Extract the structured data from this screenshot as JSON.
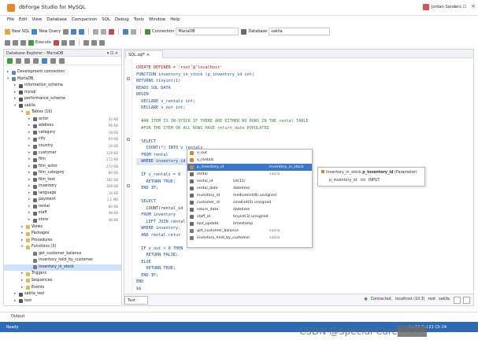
{
  "window": {
    "title": "dbForge Studio for MySQL",
    "user": "Jordan Sanders"
  },
  "menu": [
    "File",
    "Edit",
    "View",
    "Database",
    "Comparison",
    "SQL",
    "Debug",
    "Tools",
    "Window",
    "Help"
  ],
  "toolbar1": {
    "new_sql": "New SQL",
    "new_query": "New Query",
    "connection_label": "Connection",
    "connection_value": "MariaDB",
    "database_label": "Database",
    "database_value": "sakila"
  },
  "toolbar2": {
    "execute": "Execute"
  },
  "explorer": {
    "title": "Database Explorer - MariaDB",
    "items": [
      {
        "label": "Development connection",
        "level": 0,
        "arrow": "▸",
        "color": "#5a86c5"
      },
      {
        "label": "MariaDB",
        "level": 0,
        "arrow": "▾",
        "color": "#5a86c5"
      },
      {
        "label": "information_schema",
        "level": 1,
        "arrow": "▸",
        "color": "#555"
      },
      {
        "label": "mysql",
        "level": 1,
        "arrow": "▸",
        "color": "#555"
      },
      {
        "label": "performance_schema",
        "level": 1,
        "arrow": "▸",
        "color": "#555"
      },
      {
        "label": "sakila",
        "level": 1,
        "arrow": "▾",
        "color": "#555"
      },
      {
        "label": "Tables (16)",
        "level": 2,
        "arrow": "▾",
        "color": "#e3b84c"
      },
      {
        "label": "actor",
        "level": 3,
        "arrow": "▸",
        "color": "#6b6b6b",
        "size": "32 KB"
      },
      {
        "label": "address",
        "level": 3,
        "arrow": "▸",
        "color": "#6b6b6b",
        "size": "96 KB"
      },
      {
        "label": "category",
        "level": 3,
        "arrow": "▸",
        "color": "#6b6b6b",
        "size": "16 KB"
      },
      {
        "label": "city",
        "level": 3,
        "arrow": "▸",
        "color": "#6b6b6b",
        "size": "64 KB"
      },
      {
        "label": "country",
        "level": 3,
        "arrow": "▸",
        "color": "#6b6b6b",
        "size": "16 KB"
      },
      {
        "label": "customer",
        "level": 3,
        "arrow": "▸",
        "color": "#6b6b6b",
        "size": "128 KB"
      },
      {
        "label": "film",
        "level": 3,
        "arrow": "▸",
        "color": "#6b6b6b",
        "size": "272 KB"
      },
      {
        "label": "film_actor",
        "level": 3,
        "arrow": "▸",
        "color": "#6b6b6b",
        "size": "272 KB"
      },
      {
        "label": "film_category",
        "level": 3,
        "arrow": "▸",
        "color": "#6b6b6b",
        "size": "80 KB"
      },
      {
        "label": "film_text",
        "level": 3,
        "arrow": "▸",
        "color": "#6b6b6b",
        "size": "182 KB"
      },
      {
        "label": "inventory",
        "level": 3,
        "arrow": "▸",
        "color": "#6b6b6b",
        "size": "368 KB"
      },
      {
        "label": "language",
        "level": 3,
        "arrow": "▸",
        "color": "#6b6b6b",
        "size": "16 KB"
      },
      {
        "label": "payment",
        "level": 3,
        "arrow": "▸",
        "color": "#6b6b6b",
        "size": "2.1 MB"
      },
      {
        "label": "rental",
        "level": 3,
        "arrow": "▸",
        "color": "#6b6b6b",
        "size": "80 KB"
      },
      {
        "label": "staff",
        "level": 3,
        "arrow": "▸",
        "color": "#6b6b6b",
        "size": "48 KB"
      },
      {
        "label": "store",
        "level": 3,
        "arrow": "▸",
        "color": "#6b6b6b",
        "size": "48 KB"
      },
      {
        "label": "Views",
        "level": 2,
        "arrow": "▸",
        "color": "#e3b84c"
      },
      {
        "label": "Packages",
        "level": 2,
        "arrow": "▸",
        "color": "#e3b84c"
      },
      {
        "label": "Procedures",
        "level": 2,
        "arrow": "▸",
        "color": "#e3b84c"
      },
      {
        "label": "Functions (3)",
        "level": 2,
        "arrow": "▾",
        "color": "#e3b84c"
      },
      {
        "label": "get_customer_balance",
        "level": 3,
        "arrow": "",
        "color": "#7a7a7a"
      },
      {
        "label": "inventory_held_by_customer",
        "level": 3,
        "arrow": "",
        "color": "#7a7a7a"
      },
      {
        "label": "inventory_in_stock",
        "level": 3,
        "arrow": "",
        "color": "#7a7a7a",
        "selected": true
      },
      {
        "label": "Triggers",
        "level": 2,
        "arrow": "▸",
        "color": "#e3b84c"
      },
      {
        "label": "Sequences",
        "level": 2,
        "arrow": "▸",
        "color": "#e3b84c"
      },
      {
        "label": "Events",
        "level": 2,
        "arrow": "▸",
        "color": "#e3b84c"
      },
      {
        "label": "sakila_test",
        "level": 1,
        "arrow": "▸",
        "color": "#555"
      },
      {
        "label": "test",
        "level": 1,
        "arrow": "▸",
        "color": "#555"
      }
    ]
  },
  "editor": {
    "tab": "SQL.sql*",
    "code": [
      "CREATE DEFINER = 'root'@'localhost'",
      "FUNCTION inventory_in_stock (p_inventory_id int)",
      "RETURNS tinyint(1)",
      "READS SQL DATA",
      "BEGIN",
      "  DECLARE v_rentals int;",
      "  DECLARE v_out int;",
      "",
      "  #AN ITEM IS IN-STOCK IF THERE ARE EITHER NO ROWS IN THE rental TABLE",
      "  #FOR THE ITEM OR ALL ROWS HAVE return_date POPULATED",
      "",
      "  SELECT",
      "    COUNT(*) INTO v_rentals",
      "  FROM rental",
      "  WHERE inventory_id = ;",
      "",
      "  IF v_rentals = 0",
      "    RETURN TRUE;",
      "  END IF;",
      "",
      "  SELECT",
      "    COUNT(rental_id",
      "  FROM inventory",
      "    LEFT JOIN rental",
      "  WHERE inventory.",
      "  AND rental.retur",
      "",
      "  IF v_out > 0 THEN",
      "    RETURN FALSE;",
      "  ELSE",
      "    RETURN TRUE;",
      "  END IF;",
      "END",
      "$$",
      "",
      "DELIMITER ;"
    ],
    "text_tab": "Text",
    "connection_status": [
      "Connected.",
      "localhost (10.3)",
      "root",
      "sakila"
    ]
  },
  "autocomplete": [
    {
      "name": "v_out",
      "type": "",
      "origin": "",
      "color": "#d18b2c"
    },
    {
      "name": "v_rentals",
      "type": "",
      "origin": "",
      "color": "#d18b2c"
    },
    {
      "name": "p_inventory_id",
      "type": "",
      "origin": "inventory_in_stock",
      "color": "#d18b2c",
      "selected": true
    },
    {
      "name": "rental",
      "type": "",
      "origin": "sakila",
      "color": "#6b6b6b"
    },
    {
      "name": "rental_id",
      "type": "int(11)",
      "origin": "",
      "color": "#6b6b6b"
    },
    {
      "name": "rental_date",
      "type": "datetime",
      "origin": "",
      "color": "#6b6b6b"
    },
    {
      "name": "inventory_id",
      "type": "mediumint(8) unsigned",
      "origin": "",
      "color": "#6b6b6b"
    },
    {
      "name": "customer_id",
      "type": "smallint(5) unsigned",
      "origin": "",
      "color": "#6b6b6b"
    },
    {
      "name": "return_date",
      "type": "datetime",
      "origin": "",
      "color": "#6b6b6b"
    },
    {
      "name": "staff_id",
      "type": "tinyint(3) unsigned",
      "origin": "",
      "color": "#6b6b6b"
    },
    {
      "name": "last_update",
      "type": "timestamp",
      "origin": "",
      "color": "#6b6b6b"
    },
    {
      "name": "get_customer_balance",
      "type": "",
      "origin": "sakila",
      "color": "#7a7a7a"
    },
    {
      "name": "inventory_held_by_customer",
      "type": "",
      "origin": "sakila",
      "color": "#7a7a7a"
    }
  ],
  "tooltip": {
    "line1_prefix": "inventory_in_stock.",
    "line1_name": "p_inventory_id",
    "line1_suffix": "(Parameter)",
    "line2_name": "p_inventory_id",
    "line2_dir": "int",
    "line2_mode": "INPUT"
  },
  "output": "Output",
  "status": {
    "left": "Ready",
    "right": "Ln 16   Col 21   Ch 24"
  },
  "watermark": "CSDN @Special Care████"
}
